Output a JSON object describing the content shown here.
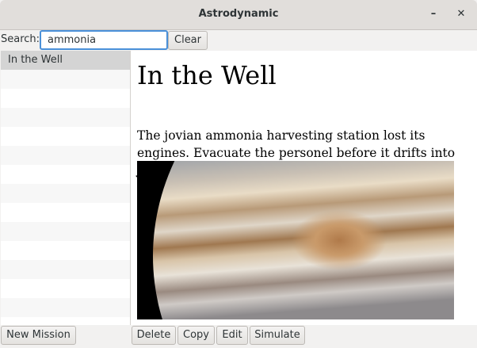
{
  "window": {
    "title": "Astrodynamic",
    "minimize_icon": "minimize-icon",
    "close_icon": "close-icon"
  },
  "toolbar": {
    "search_label": "Search:",
    "search_value": "ammonia",
    "clear_label": "Clear"
  },
  "missions": {
    "items": [
      {
        "label": "In the Well",
        "selected": true
      }
    ]
  },
  "detail": {
    "title": "In the Well",
    "description": "The jovian ammonia harvesting station lost its engines. Evacuate the personel before it drifts into Jupiter.",
    "image": "jupiter-photo"
  },
  "actions": {
    "new_mission": "New Mission",
    "delete": "Delete",
    "copy": "Copy",
    "edit": "Edit",
    "simulate": "Simulate"
  }
}
